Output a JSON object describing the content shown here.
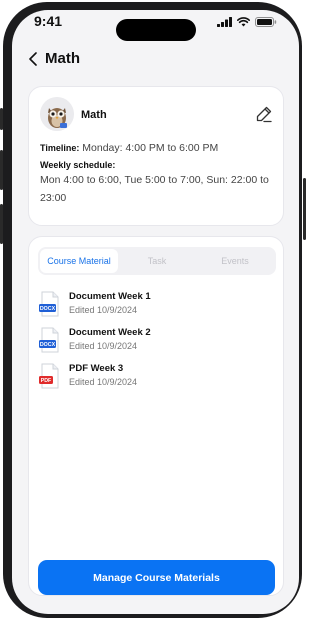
{
  "status_bar": {
    "time": "9:41"
  },
  "header": {
    "title": "Math"
  },
  "course": {
    "name": "Math",
    "timeline_label": "Timeline:",
    "timeline_value": "Monday: 4:00 PM to 6:00 PM",
    "weekly_label": "Weekly schedule:",
    "weekly_value": "Mon 4:00 to 6:00, Tue 5:00 to 7:00, Sun: 22:00 to 23:00"
  },
  "tabs": [
    {
      "label": "Course Material",
      "active": true
    },
    {
      "label": "Task",
      "active": false
    },
    {
      "label": "Events",
      "active": false
    }
  ],
  "documents": [
    {
      "title": "Document Week 1",
      "meta": "Edited 10/9/2024",
      "type": "DOCX",
      "badge_color": "#1f5fd6"
    },
    {
      "title": "Document Week 2",
      "meta": "Edited 10/9/2024",
      "type": "DOCX",
      "badge_color": "#1f5fd6"
    },
    {
      "title": "PDF Week 3",
      "meta": "Edited 10/9/2024",
      "type": "PDF",
      "badge_color": "#e02b2b"
    }
  ],
  "actions": {
    "manage_label": "Manage Course Materials"
  },
  "colors": {
    "accent": "#0a73f3",
    "tab_active_text": "#1a73e8"
  }
}
